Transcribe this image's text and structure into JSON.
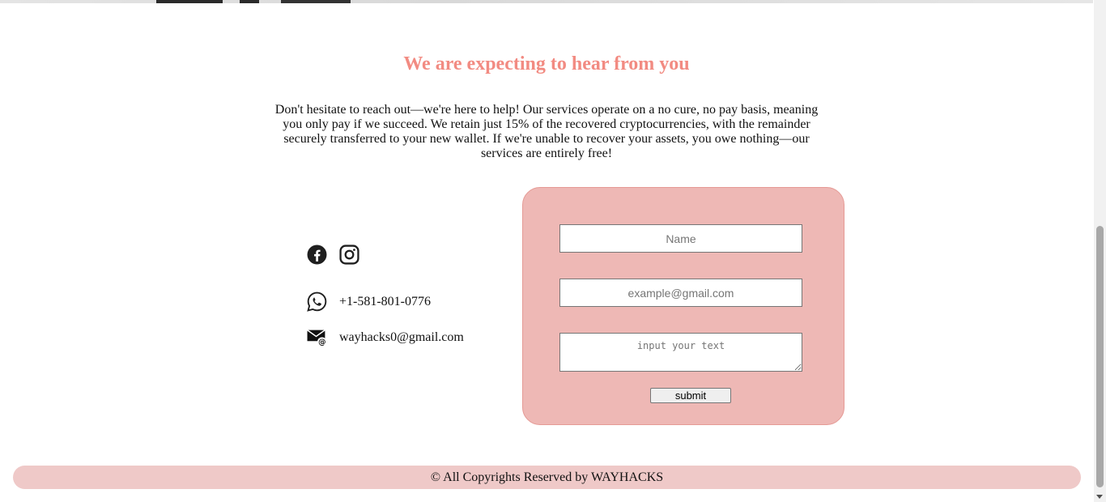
{
  "contact_section": {
    "heading": "We are expecting to hear from you",
    "intro": "Don't hesitate to reach out—we're here to help! Our services operate on a no cure, no pay basis, meaning you only pay if we succeed. We retain just 15% of the recovered cryptocurrencies, with the remainder securely transferred to your new wallet. If we're unable to recover your assets, you owe nothing—our services are entirely free!"
  },
  "contact_info": {
    "social_icons": [
      "facebook-icon",
      "instagram-icon"
    ],
    "phone": "+1-581-801-0776",
    "phone_icon": "whatsapp-icon",
    "email": "wayhacks0@gmail.com",
    "email_icon": "mail-icon"
  },
  "form": {
    "name_placeholder": "Name",
    "email_placeholder": "example@gmail.com",
    "message_placeholder": "input your text",
    "submit_label": "submit"
  },
  "footer": {
    "text": "© All Copyrights Reserved by WAYHACKS"
  },
  "colors": {
    "heading": "#f28b82",
    "form_card": "#eeb8b5",
    "footer": "#efc9c8"
  }
}
